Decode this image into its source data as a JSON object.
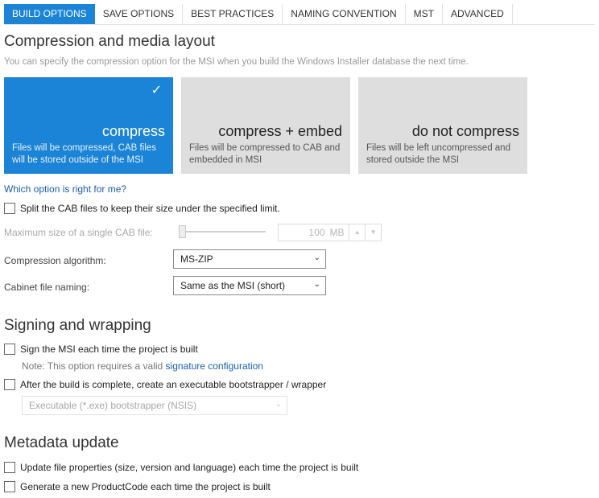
{
  "tabs": [
    {
      "label": "BUILD OPTIONS",
      "active": true
    },
    {
      "label": "SAVE OPTIONS",
      "active": false
    },
    {
      "label": "BEST PRACTICES",
      "active": false
    },
    {
      "label": "NAMING CONVENTION",
      "active": false
    },
    {
      "label": "MST",
      "active": false
    },
    {
      "label": "ADVANCED",
      "active": false
    }
  ],
  "compression": {
    "title": "Compression and media layout",
    "description": "You can specify the compression option for the MSI when you build the Windows Installer database the next time.",
    "cards": [
      {
        "title": "compress",
        "description": "Files will be compressed, CAB files will be stored outside of the MSI",
        "selected": true,
        "check_icon": "✓"
      },
      {
        "title": "compress + embed",
        "description": "Files will be compressed to CAB and embedded in MSI",
        "selected": false
      },
      {
        "title": "do not compress",
        "description": "Files will be left uncompressed and stored outside the MSI",
        "selected": false
      }
    ],
    "help_link": "Which option is right for me?",
    "split_cab_label": "Split the CAB files to keep their size under the specified limit.",
    "split_cab_checked": false,
    "max_size_label": "Maximum size of a single CAB file:",
    "max_size_value": "100",
    "max_size_unit": "MB",
    "spin_up_icon": "▲",
    "spin_down_icon": "▼",
    "algorithm_label": "Compression algorithm:",
    "algorithm_value": "MS-ZIP",
    "cabinet_naming_label": "Cabinet file naming:",
    "cabinet_naming_value": "Same as the MSI (short)",
    "dropdown_icon": "⌄"
  },
  "signing": {
    "title": "Signing and wrapping",
    "sign_label": "Sign the MSI each time the project is built",
    "sign_checked": false,
    "note_text": "Note: This option requires a valid ",
    "note_link": "signature configuration",
    "wrap_label": "After the build is complete, create an executable bootstrapper / wrapper",
    "wrap_checked": false,
    "wrap_type_value": "Executable (*.exe) bootstrapper (NSIS)"
  },
  "metadata": {
    "title": "Metadata update",
    "update_props_label": "Update file properties (size, version and language) each time the project is built",
    "update_props_checked": false,
    "productcode_label": "Generate a new ProductCode each time the project is built",
    "productcode_checked": false
  },
  "colors": {
    "accent": "#1b84d6",
    "card_inactive": "#dedede",
    "link": "#1b5fa8"
  }
}
